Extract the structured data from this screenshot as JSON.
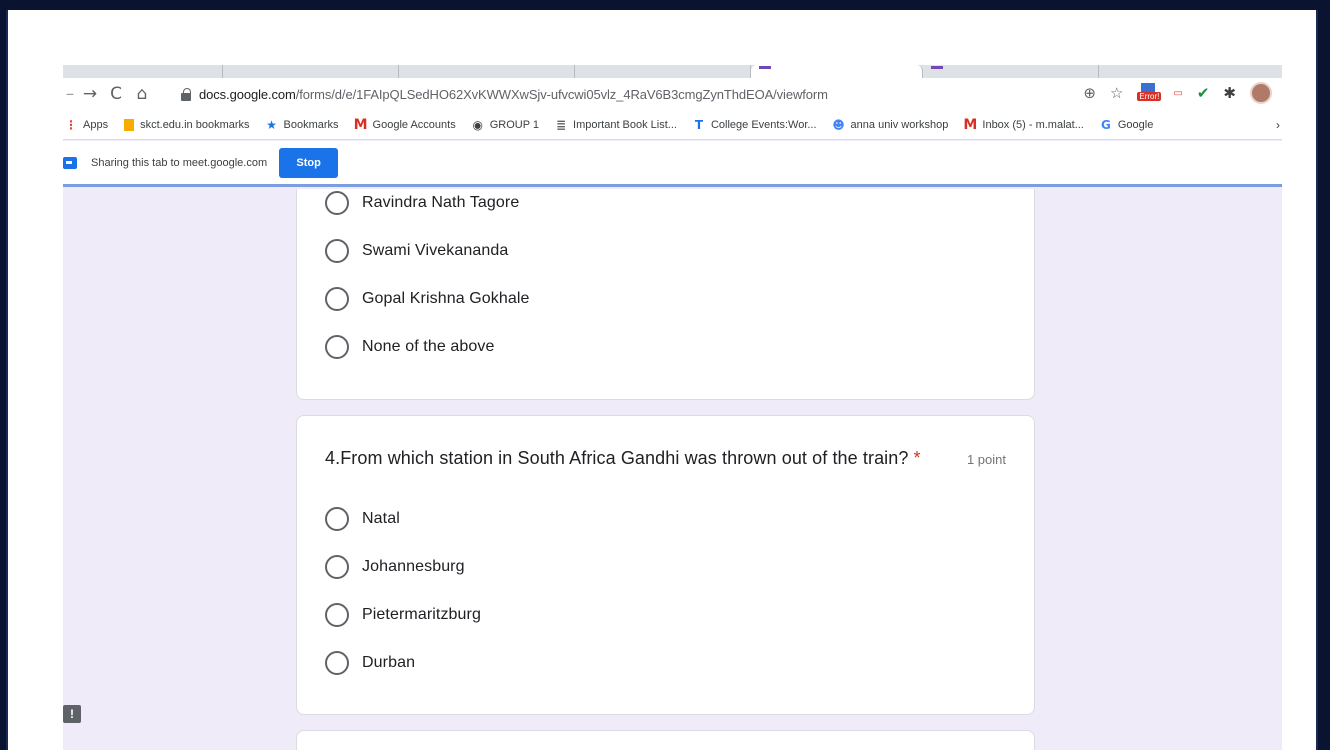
{
  "browser": {
    "url_host": "docs.google.com",
    "url_path": "/forms/d/e/1FAIpQLSedHO62XvKWWXwSjv-ufvcwi05vlz_4RaV6B3cmgZynThdEOA/viewform",
    "error_badge": "Error!"
  },
  "bookmarks": [
    {
      "label": "Apps",
      "icon": "apps-grid-icon",
      "color": "#ea4335"
    },
    {
      "label": "skct.edu.in bookmarks",
      "icon": "folder-icon",
      "color": "#f9ab00"
    },
    {
      "label": "Bookmarks",
      "icon": "star-icon",
      "color": "#1a73e8"
    },
    {
      "label": "Google Accounts",
      "icon": "gmail-icon",
      "color": "#d93025"
    },
    {
      "label": "GROUP 1",
      "icon": "globe-icon",
      "color": "#3c4043"
    },
    {
      "label": "Important Book List...",
      "icon": "book-icon",
      "color": "#5f6368"
    },
    {
      "label": "College Events:Wor...",
      "icon": "t-icon",
      "color": "#1a73e8"
    },
    {
      "label": "anna univ workshop",
      "icon": "avatar-icon",
      "color": "#4285f4"
    },
    {
      "label": "Inbox (5) - m.malat...",
      "icon": "gmail-icon",
      "color": "#d93025"
    },
    {
      "label": "Google",
      "icon": "google-g-icon",
      "color": "#4285f4"
    }
  ],
  "share_bar": {
    "text": "Sharing this tab to meet.google.com",
    "stop_label": "Stop"
  },
  "question3": {
    "options": [
      "Ravindra Nath Tagore",
      "Swami Vivekananda",
      "Gopal Krishna Gokhale",
      "None of the above"
    ]
  },
  "question4": {
    "title": "4.From which station in South Africa Gandhi was thrown out of the train?",
    "required_mark": "*",
    "points": "1 point",
    "options": [
      "Natal",
      "Johannesburg",
      "Pietermaritzburg",
      "Durban"
    ]
  },
  "feedback_icon": "!",
  "colors": {
    "form_background": "#f0ebf8",
    "accent_blue": "#1a73e8",
    "required_red": "#d93025"
  }
}
